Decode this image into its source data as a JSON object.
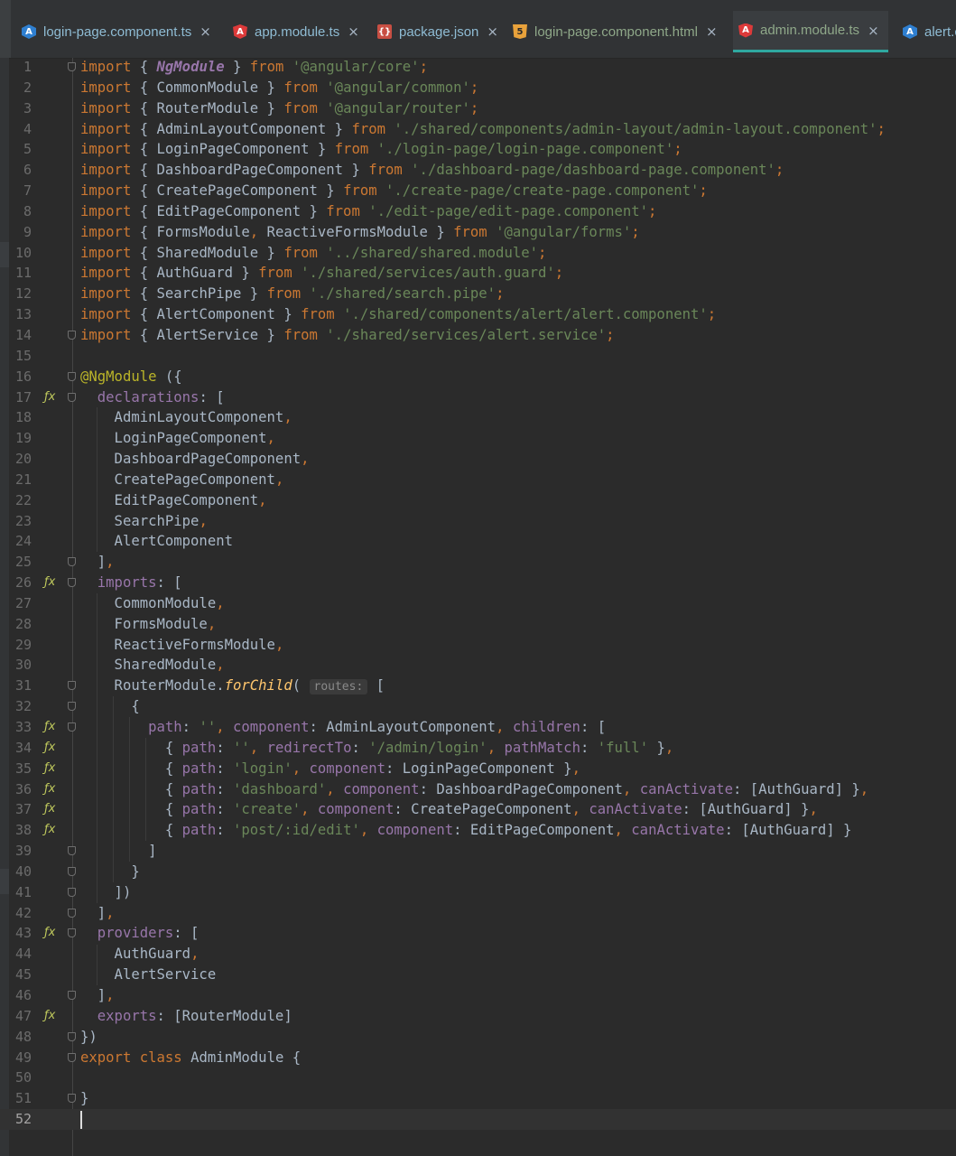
{
  "tabs": [
    {
      "label": "login-page.component.ts",
      "icon": "typescript-icon",
      "iconglyph": "A",
      "color": "#8fbcd4",
      "active": false
    },
    {
      "label": "app.module.ts",
      "icon": "angular-icon",
      "iconglyph": "A",
      "color": "#8fbcd4",
      "active": false
    },
    {
      "label": "package.json",
      "icon": "json-file-icon",
      "iconglyph": "{}",
      "color": "#8fbcd4",
      "active": false
    },
    {
      "label": "login-page.component.html",
      "icon": "html5-icon",
      "iconglyph": "5",
      "color": "#8fa889",
      "active": false
    },
    {
      "label": "admin.module.ts",
      "icon": "angular-icon",
      "iconglyph": "A",
      "color": "#8fa889",
      "active": true
    },
    {
      "label": "alert.c",
      "icon": "typescript-icon",
      "iconglyph": "A",
      "color": "#8fbcd4",
      "active": false
    }
  ],
  "close_glyph": "×",
  "gutter": {
    "fx_glyph": "ƒx"
  },
  "inlay_hint": "routes:",
  "code_lines": [
    {
      "n": "1",
      "fold": true,
      "tokens": [
        [
          "kw",
          "import"
        ],
        [
          "p",
          " { "
        ],
        [
          "ngm",
          "NgModule"
        ],
        [
          "p",
          " } "
        ],
        [
          "kw",
          "from"
        ],
        [
          "p",
          " "
        ],
        [
          "str",
          "'@angular/core'"
        ],
        [
          "kw",
          ";"
        ]
      ]
    },
    {
      "n": "2",
      "tokens": [
        [
          "kw",
          "import"
        ],
        [
          "p",
          " { CommonModule } "
        ],
        [
          "kw",
          "from"
        ],
        [
          "p",
          " "
        ],
        [
          "str",
          "'@angular/common'"
        ],
        [
          "kw",
          ";"
        ]
      ]
    },
    {
      "n": "3",
      "tokens": [
        [
          "kw",
          "import"
        ],
        [
          "p",
          " { RouterModule } "
        ],
        [
          "kw",
          "from"
        ],
        [
          "p",
          " "
        ],
        [
          "str",
          "'@angular/router'"
        ],
        [
          "kw",
          ";"
        ]
      ]
    },
    {
      "n": "4",
      "tokens": [
        [
          "kw",
          "import"
        ],
        [
          "p",
          " { AdminLayoutComponent } "
        ],
        [
          "kw",
          "from"
        ],
        [
          "p",
          " "
        ],
        [
          "str",
          "'./shared/components/admin-layout/admin-layout.component'"
        ],
        [
          "kw",
          ";"
        ]
      ]
    },
    {
      "n": "5",
      "tokens": [
        [
          "kw",
          "import"
        ],
        [
          "p",
          " { LoginPageComponent } "
        ],
        [
          "kw",
          "from"
        ],
        [
          "p",
          " "
        ],
        [
          "str",
          "'./login-page/login-page.component'"
        ],
        [
          "kw",
          ";"
        ]
      ]
    },
    {
      "n": "6",
      "tokens": [
        [
          "kw",
          "import"
        ],
        [
          "p",
          " { DashboardPageComponent } "
        ],
        [
          "kw",
          "from"
        ],
        [
          "p",
          " "
        ],
        [
          "str",
          "'./dashboard-page/dashboard-page.component'"
        ],
        [
          "kw",
          ";"
        ]
      ]
    },
    {
      "n": "7",
      "tokens": [
        [
          "kw",
          "import"
        ],
        [
          "p",
          " { CreatePageComponent } "
        ],
        [
          "kw",
          "from"
        ],
        [
          "p",
          " "
        ],
        [
          "str",
          "'./create-page/create-page.component'"
        ],
        [
          "kw",
          ";"
        ]
      ]
    },
    {
      "n": "8",
      "tokens": [
        [
          "kw",
          "import"
        ],
        [
          "p",
          " { EditPageComponent } "
        ],
        [
          "kw",
          "from"
        ],
        [
          "p",
          " "
        ],
        [
          "str",
          "'./edit-page/edit-page.component'"
        ],
        [
          "kw",
          ";"
        ]
      ]
    },
    {
      "n": "9",
      "tokens": [
        [
          "kw",
          "import"
        ],
        [
          "p",
          " { FormsModule"
        ],
        [
          "kw",
          ","
        ],
        [
          "p",
          " ReactiveFormsModule } "
        ],
        [
          "kw",
          "from"
        ],
        [
          "p",
          " "
        ],
        [
          "str",
          "'@angular/forms'"
        ],
        [
          "kw",
          ";"
        ]
      ]
    },
    {
      "n": "10",
      "tokens": [
        [
          "kw",
          "import"
        ],
        [
          "p",
          " { SharedModule } "
        ],
        [
          "kw",
          "from"
        ],
        [
          "p",
          " "
        ],
        [
          "str",
          "'../shared/shared.module'"
        ],
        [
          "kw",
          ";"
        ]
      ]
    },
    {
      "n": "11",
      "tokens": [
        [
          "kw",
          "import"
        ],
        [
          "p",
          " { AuthGuard } "
        ],
        [
          "kw",
          "from"
        ],
        [
          "p",
          " "
        ],
        [
          "str",
          "'./shared/services/auth.guard'"
        ],
        [
          "kw",
          ";"
        ]
      ]
    },
    {
      "n": "12",
      "tokens": [
        [
          "kw",
          "import"
        ],
        [
          "p",
          " { SearchPipe } "
        ],
        [
          "kw",
          "from"
        ],
        [
          "p",
          " "
        ],
        [
          "str",
          "'./shared/search.pipe'"
        ],
        [
          "kw",
          ";"
        ]
      ]
    },
    {
      "n": "13",
      "tokens": [
        [
          "kw",
          "import"
        ],
        [
          "p",
          " { AlertComponent } "
        ],
        [
          "kw",
          "from"
        ],
        [
          "p",
          " "
        ],
        [
          "str",
          "'./shared/components/alert/alert.component'"
        ],
        [
          "kw",
          ";"
        ]
      ]
    },
    {
      "n": "14",
      "fold": true,
      "tokens": [
        [
          "kw",
          "import"
        ],
        [
          "p",
          " { AlertService } "
        ],
        [
          "kw",
          "from"
        ],
        [
          "p",
          " "
        ],
        [
          "str",
          "'./shared/services/alert.service'"
        ],
        [
          "kw",
          ";"
        ]
      ]
    },
    {
      "n": "15",
      "tokens": []
    },
    {
      "n": "16",
      "fold": true,
      "tokens": [
        [
          "ann",
          "@NgModule"
        ],
        [
          "p",
          " ({"
        ]
      ]
    },
    {
      "n": "17",
      "fx": true,
      "fold": true,
      "tokens": [
        [
          "p",
          "  "
        ],
        [
          "prop",
          "declarations"
        ],
        [
          "p",
          ": ["
        ]
      ]
    },
    {
      "n": "18",
      "tokens": [
        [
          "p",
          "    AdminLayoutComponent"
        ],
        [
          "kw",
          ","
        ]
      ]
    },
    {
      "n": "19",
      "tokens": [
        [
          "p",
          "    LoginPageComponent"
        ],
        [
          "kw",
          ","
        ]
      ]
    },
    {
      "n": "20",
      "tokens": [
        [
          "p",
          "    DashboardPageComponent"
        ],
        [
          "kw",
          ","
        ]
      ]
    },
    {
      "n": "21",
      "tokens": [
        [
          "p",
          "    CreatePageComponent"
        ],
        [
          "kw",
          ","
        ]
      ]
    },
    {
      "n": "22",
      "tokens": [
        [
          "p",
          "    EditPageComponent"
        ],
        [
          "kw",
          ","
        ]
      ]
    },
    {
      "n": "23",
      "tokens": [
        [
          "p",
          "    SearchPipe"
        ],
        [
          "kw",
          ","
        ]
      ]
    },
    {
      "n": "24",
      "tokens": [
        [
          "p",
          "    AlertComponent"
        ]
      ]
    },
    {
      "n": "25",
      "fold": true,
      "tokens": [
        [
          "p",
          "  ]"
        ],
        [
          "kw",
          ","
        ]
      ]
    },
    {
      "n": "26",
      "fx": true,
      "fold": true,
      "tokens": [
        [
          "p",
          "  "
        ],
        [
          "prop",
          "imports"
        ],
        [
          "p",
          ": ["
        ]
      ]
    },
    {
      "n": "27",
      "tokens": [
        [
          "p",
          "    CommonModule"
        ],
        [
          "kw",
          ","
        ]
      ]
    },
    {
      "n": "28",
      "tokens": [
        [
          "p",
          "    FormsModule"
        ],
        [
          "kw",
          ","
        ]
      ]
    },
    {
      "n": "29",
      "tokens": [
        [
          "p",
          "    ReactiveFormsModule"
        ],
        [
          "kw",
          ","
        ]
      ]
    },
    {
      "n": "30",
      "tokens": [
        [
          "p",
          "    SharedModule"
        ],
        [
          "kw",
          ","
        ]
      ]
    },
    {
      "n": "31",
      "fold": true,
      "tokens": [
        [
          "p",
          "    RouterModule."
        ],
        [
          "fn",
          "forChild"
        ],
        [
          "p",
          "( "
        ],
        [
          "hint",
          "routes:"
        ],
        [
          "p",
          " ["
        ]
      ]
    },
    {
      "n": "32",
      "fold": true,
      "tokens": [
        [
          "p",
          "      {"
        ]
      ]
    },
    {
      "n": "33",
      "fx": true,
      "fold": true,
      "tokens": [
        [
          "p",
          "        "
        ],
        [
          "prop",
          "path"
        ],
        [
          "p",
          ": "
        ],
        [
          "str",
          "''"
        ],
        [
          "kw",
          ","
        ],
        [
          "p",
          " "
        ],
        [
          "prop",
          "component"
        ],
        [
          "p",
          ": AdminLayoutComponent"
        ],
        [
          "kw",
          ","
        ],
        [
          "p",
          " "
        ],
        [
          "prop",
          "children"
        ],
        [
          "p",
          ": ["
        ]
      ]
    },
    {
      "n": "34",
      "fx": true,
      "tokens": [
        [
          "p",
          "          { "
        ],
        [
          "prop",
          "path"
        ],
        [
          "p",
          ": "
        ],
        [
          "str",
          "''"
        ],
        [
          "kw",
          ","
        ],
        [
          "p",
          " "
        ],
        [
          "prop",
          "redirectTo"
        ],
        [
          "p",
          ": "
        ],
        [
          "str",
          "'/admin/login'"
        ],
        [
          "kw",
          ","
        ],
        [
          "p",
          " "
        ],
        [
          "prop",
          "pathMatch"
        ],
        [
          "p",
          ": "
        ],
        [
          "str",
          "'full'"
        ],
        [
          "p",
          " }"
        ],
        [
          "kw",
          ","
        ]
      ]
    },
    {
      "n": "35",
      "fx": true,
      "tokens": [
        [
          "p",
          "          { "
        ],
        [
          "prop",
          "path"
        ],
        [
          "p",
          ": "
        ],
        [
          "str",
          "'login'"
        ],
        [
          "kw",
          ","
        ],
        [
          "p",
          " "
        ],
        [
          "prop",
          "component"
        ],
        [
          "p",
          ": LoginPageComponent }"
        ],
        [
          "kw",
          ","
        ]
      ]
    },
    {
      "n": "36",
      "fx": true,
      "tokens": [
        [
          "p",
          "          { "
        ],
        [
          "prop",
          "path"
        ],
        [
          "p",
          ": "
        ],
        [
          "str",
          "'dashboard'"
        ],
        [
          "kw",
          ","
        ],
        [
          "p",
          " "
        ],
        [
          "prop",
          "component"
        ],
        [
          "p",
          ": DashboardPageComponent"
        ],
        [
          "kw",
          ","
        ],
        [
          "p",
          " "
        ],
        [
          "prop",
          "canActivate"
        ],
        [
          "p",
          ": [AuthGuard] }"
        ],
        [
          "kw",
          ","
        ]
      ]
    },
    {
      "n": "37",
      "fx": true,
      "tokens": [
        [
          "p",
          "          { "
        ],
        [
          "prop",
          "path"
        ],
        [
          "p",
          ": "
        ],
        [
          "str",
          "'create'"
        ],
        [
          "kw",
          ","
        ],
        [
          "p",
          " "
        ],
        [
          "prop",
          "component"
        ],
        [
          "p",
          ": CreatePageComponent"
        ],
        [
          "kw",
          ","
        ],
        [
          "p",
          " "
        ],
        [
          "prop",
          "canActivate"
        ],
        [
          "p",
          ": [AuthGuard] }"
        ],
        [
          "kw",
          ","
        ]
      ]
    },
    {
      "n": "38",
      "fx": true,
      "tokens": [
        [
          "p",
          "          { "
        ],
        [
          "prop",
          "path"
        ],
        [
          "p",
          ": "
        ],
        [
          "str",
          "'post/:id/edit'"
        ],
        [
          "kw",
          ","
        ],
        [
          "p",
          " "
        ],
        [
          "prop",
          "component"
        ],
        [
          "p",
          ": EditPageComponent"
        ],
        [
          "kw",
          ","
        ],
        [
          "p",
          " "
        ],
        [
          "prop",
          "canActivate"
        ],
        [
          "p",
          ": [AuthGuard] }"
        ]
      ]
    },
    {
      "n": "39",
      "fold": true,
      "tokens": [
        [
          "p",
          "        ]"
        ]
      ]
    },
    {
      "n": "40",
      "fold": true,
      "tokens": [
        [
          "p",
          "      }"
        ]
      ]
    },
    {
      "n": "41",
      "fold": true,
      "tokens": [
        [
          "p",
          "    ])"
        ]
      ]
    },
    {
      "n": "42",
      "fold": true,
      "tokens": [
        [
          "p",
          "  ]"
        ],
        [
          "kw",
          ","
        ]
      ]
    },
    {
      "n": "43",
      "fx": true,
      "fold": true,
      "tokens": [
        [
          "p",
          "  "
        ],
        [
          "prop",
          "providers"
        ],
        [
          "p",
          ": ["
        ]
      ]
    },
    {
      "n": "44",
      "tokens": [
        [
          "p",
          "    AuthGuard"
        ],
        [
          "kw",
          ","
        ]
      ]
    },
    {
      "n": "45",
      "tokens": [
        [
          "p",
          "    AlertService"
        ]
      ]
    },
    {
      "n": "46",
      "fold": true,
      "tokens": [
        [
          "p",
          "  ]"
        ],
        [
          "kw",
          ","
        ]
      ]
    },
    {
      "n": "47",
      "fx": true,
      "tokens": [
        [
          "p",
          "  "
        ],
        [
          "prop",
          "exports"
        ],
        [
          "p",
          ": [RouterModule]"
        ]
      ]
    },
    {
      "n": "48",
      "fold": true,
      "tokens": [
        [
          "p",
          "})"
        ]
      ]
    },
    {
      "n": "49",
      "fold": true,
      "tokens": [
        [
          "kw",
          "export"
        ],
        [
          "p",
          " "
        ],
        [
          "kw",
          "class"
        ],
        [
          "p",
          " AdminModule {"
        ]
      ]
    },
    {
      "n": "50",
      "tokens": []
    },
    {
      "n": "51",
      "fold": true,
      "tokens": [
        [
          "p",
          "}"
        ]
      ]
    },
    {
      "n": "52",
      "current": true,
      "caret": true,
      "tokens": []
    }
  ]
}
